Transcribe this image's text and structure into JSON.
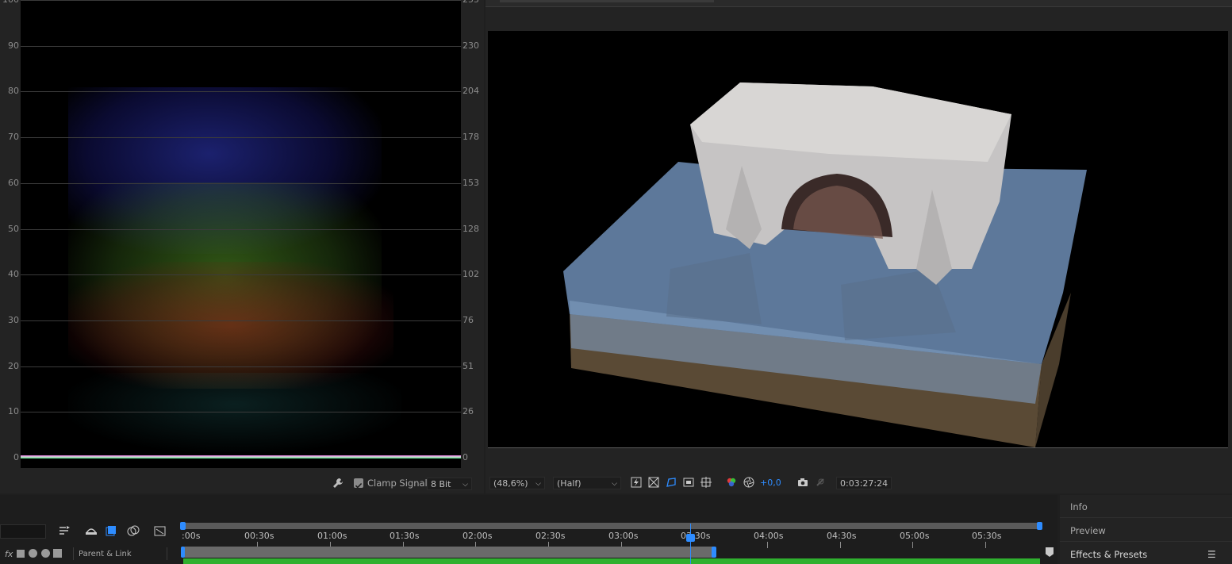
{
  "scope": {
    "left_ticks": [
      "100",
      "90",
      "80",
      "70",
      "60",
      "50",
      "40",
      "30",
      "20",
      "10",
      "0"
    ],
    "right_ticks": [
      "255",
      "230",
      "204",
      "178",
      "153",
      "128",
      "102",
      "76",
      "51",
      "26",
      "0"
    ],
    "clamp_signal_label": "Clamp Signal",
    "clamp_signal_checked": true,
    "bit_depth": "8 Bit"
  },
  "viewer": {
    "zoom": "(48,6%)",
    "resolution": "(Half)",
    "exposure": "+0,0",
    "timecode": "0:03:27:24"
  },
  "timeline": {
    "layer_header_label": "Parent & Link",
    "fx_label": "fx",
    "time_labels": [
      ":00s",
      "00:30s",
      "01:00s",
      "01:30s",
      "02:00s",
      "02:30s",
      "03:00s",
      "03:30s",
      "04:00s",
      "04:30s",
      "05:00s",
      "05:30s"
    ]
  },
  "right_panel": {
    "items": [
      "Info",
      "Preview",
      "Effects & Presets"
    ]
  },
  "colors": {
    "accent": "#2e8cff",
    "layer_bar": "#2fb02f"
  }
}
